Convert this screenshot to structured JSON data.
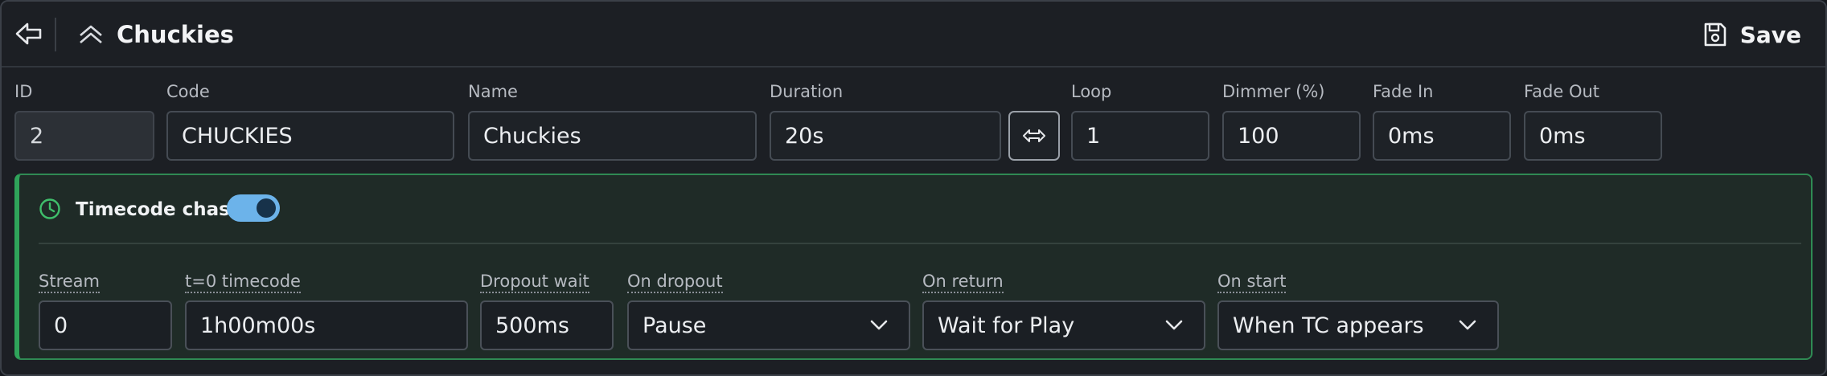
{
  "header": {
    "title": "Chuckies",
    "save_label": "Save"
  },
  "fields": {
    "id": {
      "label": "ID",
      "value": "2"
    },
    "code": {
      "label": "Code",
      "value": "CHUCKIES"
    },
    "name": {
      "label": "Name",
      "value": "Chuckies"
    },
    "duration": {
      "label": "Duration",
      "value": "20s"
    },
    "loop": {
      "label": "Loop",
      "value": "1"
    },
    "dimmer": {
      "label": "Dimmer (%)",
      "value": "100"
    },
    "fade_in": {
      "label": "Fade In",
      "value": "0ms"
    },
    "fade_out": {
      "label": "Fade Out",
      "value": "0ms"
    }
  },
  "timecode": {
    "title": "Timecode chase",
    "enabled": true,
    "stream": {
      "label": "Stream",
      "value": "0"
    },
    "t0": {
      "label": "t=0 timecode",
      "value": "1h00m00s"
    },
    "dropout_wait": {
      "label": "Dropout wait",
      "value": "500ms"
    },
    "on_dropout": {
      "label": "On dropout",
      "value": "Pause"
    },
    "on_return": {
      "label": "On return",
      "value": "Wait for Play"
    },
    "on_start": {
      "label": "On start",
      "value": "When TC appears"
    }
  },
  "colors": {
    "accent_green": "#2fa35a",
    "toggle_on": "#6cb3ea",
    "background": "#1c1f24"
  },
  "icons": {
    "back": "arrow-left-outline-icon",
    "collapse": "double-chevron-up-icon",
    "save": "floppy-disk-icon",
    "swap": "double-arrow-horizontal-icon",
    "clock": "clock-icon",
    "dropdown": "chevron-down-icon"
  }
}
